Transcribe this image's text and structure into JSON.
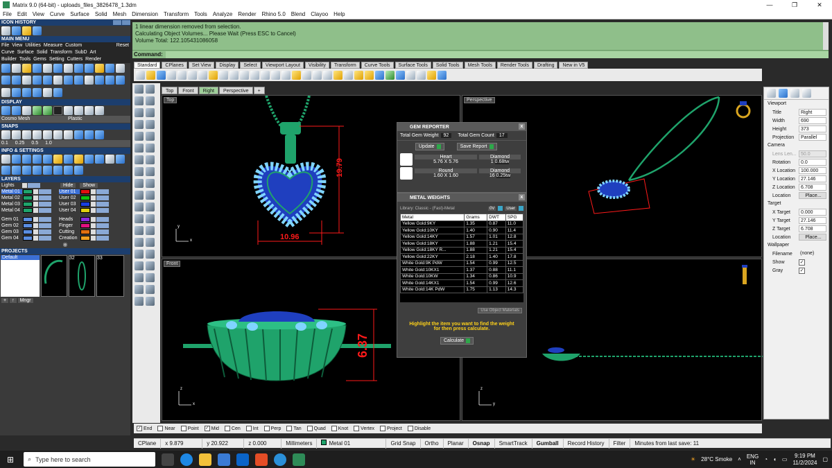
{
  "title": "Matrix 9.0 (64-bit) - uploads_files_3826478_1.3dm",
  "menu": [
    "File",
    "Edit",
    "View",
    "Curve",
    "Surface",
    "Solid",
    "Mesh",
    "Dimension",
    "Transform",
    "Tools",
    "Analyze",
    "Render",
    "Rhino 5.0",
    "Blend",
    "Clayoo",
    "Help"
  ],
  "left": {
    "icon_history": "ICON HISTORY",
    "main_menu": "MAIN MENU",
    "sub1": [
      "File",
      "View",
      "Utilities",
      "Measure",
      "Custom"
    ],
    "sub1_reset": "Reset",
    "sub2": [
      "Curve",
      "Surface",
      "Solid",
      "Transform",
      "SubD",
      "Art"
    ],
    "sub3": [
      "Builder",
      "Tools",
      "Gems",
      "Setting",
      "Cutters",
      "Render"
    ],
    "display": "DISPLAY",
    "display_labels": [
      "Cosmo Mesh",
      "Plastic"
    ],
    "snaps": "SNAPS",
    "snap_values": [
      "0.1",
      "0.25",
      "0.5",
      "1.0"
    ],
    "info": "INFO & SETTINGS",
    "layers": "LAYERS",
    "lights": "Lights",
    "hide": "Hide",
    "show": "Show",
    "layer_rows": [
      [
        "Metal 01",
        "User 01"
      ],
      [
        "Metal 02",
        "User 02"
      ],
      [
        "Metal 03",
        "User 03"
      ],
      [
        "Metal 04",
        "User 04"
      ],
      [
        "Gem 01",
        "Heads"
      ],
      [
        "Gem 02",
        "Finger"
      ],
      [
        "Gem 03",
        "Cutting"
      ],
      [
        "Gem 04",
        "Creation"
      ]
    ],
    "projects": "PROJECTS",
    "project_default": "Default",
    "project_nums": [
      "32",
      "33"
    ],
    "mngr": "Mngr"
  },
  "command": {
    "history": [
      "1 linear dimension removed from selection.",
      "Calculating Object Volumes... Please Wait (Press ESC to Cancel)",
      "Volume Total: 122.105431086058"
    ],
    "label": "Command:"
  },
  "toolbar_tabs": [
    "Standard",
    "CPlanes",
    "Set View",
    "Display",
    "Select",
    "Viewport Layout",
    "Visibility",
    "Transform",
    "Curve Tools",
    "Surface Tools",
    "Solid Tools",
    "Mesh Tools",
    "Render Tools",
    "Drafting",
    "New in V5"
  ],
  "viewport_tabs": [
    "Top",
    "Front",
    "Right",
    "Perspective"
  ],
  "viewports": {
    "top": "Top",
    "persp": "Perspective",
    "front": "Front",
    "axis_y": "y",
    "axis_x": "x",
    "axis_z": "z"
  },
  "dims": {
    "height": "19.79",
    "width": "10.96",
    "front": "6.37"
  },
  "gem_reporter": {
    "title": "GEM REPORTER",
    "total_weight_label": "Total Gem Weight",
    "total_weight": "92",
    "total_count_label": "Total Gem Count",
    "total_count": "17",
    "update": "Update",
    "save": "Save Report",
    "rows": [
      {
        "shape": "Heart",
        "size": "5.76 X 5.76",
        "type": "Diamond",
        "qty": "1",
        "ctw": "0.68tw"
      },
      {
        "shape": "Round",
        "size": "1.60 X 1.60",
        "type": "Diamond",
        "qty": "16",
        "ctw": "0.25tw"
      }
    ]
  },
  "metal_weights": {
    "title": "METAL WEIGHTS",
    "library": "Library: Classic - (Fast)-Metal",
    "opt1": "0V",
    "opt2": "User",
    "columns": [
      "Metal",
      "Grams",
      "DWT",
      "SPG"
    ],
    "rows": [
      [
        "Yellow Gold:9KY",
        "1.35",
        "0.87",
        "11.0"
      ],
      [
        "Yellow Gold:10KY",
        "1.40",
        "0.90",
        "11.4"
      ],
      [
        "Yellow Gold:14KY",
        "1.57",
        "1.01",
        "12.8"
      ],
      [
        "Yellow Gold:18KY",
        "1.88",
        "1.21",
        "15.4"
      ],
      [
        "Yellow Gold:18KY R...",
        "1.88",
        "1.21",
        "15.4"
      ],
      [
        "Yellow Gold:22KY",
        "2.18",
        "1.40",
        "17.8"
      ],
      [
        "White Gold:9K PdW",
        "1.54",
        "0.99",
        "12.5"
      ],
      [
        "White Gold:10KX1",
        "1.37",
        "0.88",
        "11.1"
      ],
      [
        "White Gold:10KW",
        "1.34",
        "0.86",
        "10.9"
      ],
      [
        "White Gold:14KX1",
        "1.54",
        "0.99",
        "12.6"
      ],
      [
        "White Gold:14K PdW",
        "1.75",
        "1.13",
        "14.3"
      ]
    ],
    "use_materials": "Use Object Materials",
    "hint": "Highlight the item you want to find the weight for then press calculate.",
    "calculate": "Calculate"
  },
  "properties": {
    "viewport": "Viewport",
    "fields": [
      [
        "Title",
        "Right"
      ],
      [
        "Width",
        "690"
      ],
      [
        "Height",
        "373"
      ],
      [
        "Projection",
        "Parallel"
      ]
    ],
    "camera": "Camera",
    "camera_fields": [
      [
        "Lens Len...",
        "50.0"
      ],
      [
        "Rotation",
        "0.0"
      ],
      [
        "X Location",
        "100.000"
      ],
      [
        "Y Location",
        "27.146"
      ],
      [
        "Z Location",
        "6.708"
      ],
      [
        "Location",
        "Place..."
      ]
    ],
    "target": "Target",
    "target_fields": [
      [
        "X Target",
        "0.000"
      ],
      [
        "Y Target",
        "27.146"
      ],
      [
        "Z Target",
        "6.708"
      ],
      [
        "Location",
        "Place..."
      ]
    ],
    "wallpaper": "Wallpaper",
    "wallpaper_fields": [
      [
        "Filename",
        "(none)"
      ]
    ],
    "show": "Show",
    "gray": "Gray"
  },
  "osnap": [
    [
      "End",
      true
    ],
    [
      "Near",
      false
    ],
    [
      "Point",
      false
    ],
    [
      "Mid",
      true
    ],
    [
      "Cen",
      false
    ],
    [
      "Int",
      false
    ],
    [
      "Perp",
      false
    ],
    [
      "Tan",
      false
    ],
    [
      "Quad",
      false
    ],
    [
      "Knot",
      false
    ],
    [
      "Vertex",
      false
    ],
    [
      "Project",
      false
    ],
    [
      "Disable",
      false
    ]
  ],
  "status": {
    "cplane": "CPlane",
    "x": "x 9.879",
    "y": "y 20.922",
    "z": "z 0.000",
    "units": "Millimeters",
    "layer": "Metal 01",
    "items": [
      "Grid Snap",
      "Ortho",
      "Planar",
      "Osnap",
      "SmartTrack",
      "Gumball",
      "Record History",
      "Filter"
    ],
    "save": "Minutes from last save: 11"
  },
  "taskbar": {
    "search": "Type here to search",
    "weather": "28°C  Smoke",
    "lang1": "ENG",
    "lang2": "IN",
    "time": "9:19 PM",
    "date": "11/2/2024"
  },
  "colors": {
    "accent": "#1c3e6e",
    "model_green": "#1fa36b",
    "dim_red": "#ff1a1a",
    "gem_blue": "#1f3fbf"
  }
}
